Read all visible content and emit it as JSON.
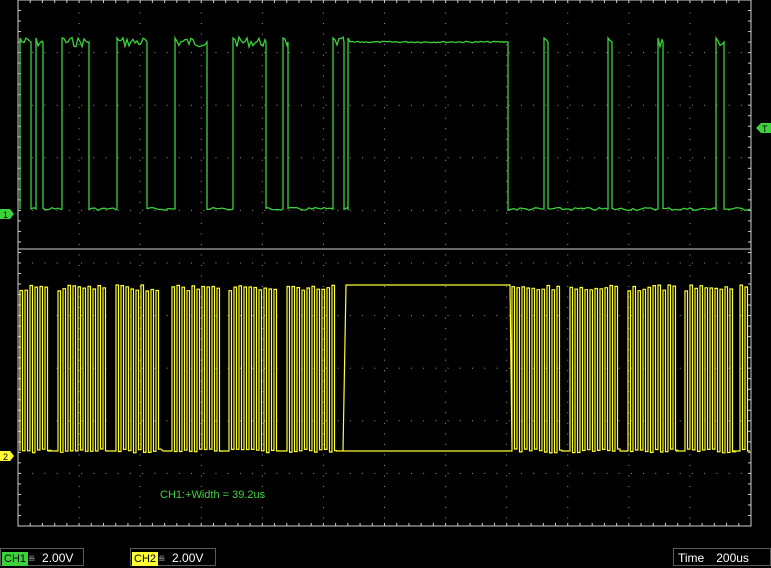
{
  "colors": {
    "ch1": "#3bd23b",
    "ch2": "#ffff33",
    "grid": "#cfcfcf",
    "background": "#000000"
  },
  "measurement": "CH1:+Width = 39.2us",
  "ch1": {
    "tag": "CH1",
    "coupling_icon": "dc-coupling-icon",
    "volts_per_div": "2.00V",
    "marker": "1"
  },
  "ch2": {
    "tag": "CH2",
    "coupling_icon": "dc-coupling-icon",
    "volts_per_div": "2.00V",
    "marker": "2"
  },
  "trigger": {
    "marker": "T"
  },
  "timebase": {
    "label": "Time",
    "value": "200us"
  }
}
